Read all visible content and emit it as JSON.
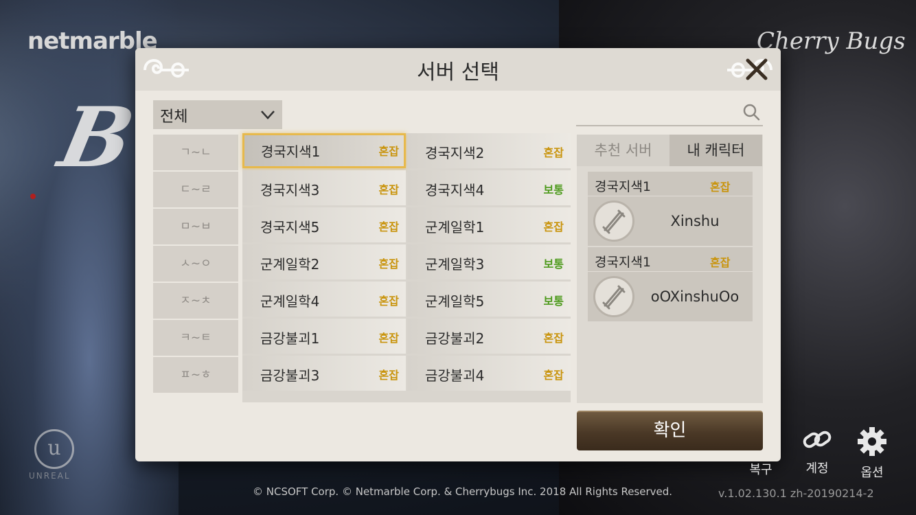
{
  "background": {
    "publisher_logo": "netmarble",
    "developer_logo": "Cherry Bugs",
    "game_logo": "B",
    "engine_logo": "UNREAL",
    "copyright": "© NCSOFT Corp. © Netmarble Corp. & Cherrybugs Inc. 2018 All Rights Reserved.",
    "version": "v.1.02.130.1  zh-20190214-2"
  },
  "bottom_bar": {
    "restore_label": "복구",
    "account_label": "계정",
    "options_label": "옵션"
  },
  "dialog": {
    "title": "서버 선택",
    "filter": {
      "selected": "전체"
    },
    "search": {
      "placeholder": ""
    },
    "initials": [
      "ㄱ~ㄴ",
      "ㄷ~ㄹ",
      "ㅁ~ㅂ",
      "ㅅ~ㅇ",
      "ㅈ~ㅊ",
      "ㅋ~ㅌ",
      "ㅍ~ㅎ"
    ],
    "servers": [
      {
        "name": "경국지색1",
        "status": "혼잡",
        "type": "busy",
        "selected": true
      },
      {
        "name": "경국지색2",
        "status": "혼잡",
        "type": "busy"
      },
      {
        "name": "경국지색3",
        "status": "혼잡",
        "type": "busy"
      },
      {
        "name": "경국지색4",
        "status": "보통",
        "type": "normal"
      },
      {
        "name": "경국지색5",
        "status": "혼잡",
        "type": "busy"
      },
      {
        "name": "군계일학1",
        "status": "혼잡",
        "type": "busy"
      },
      {
        "name": "군계일학2",
        "status": "혼잡",
        "type": "busy"
      },
      {
        "name": "군계일학3",
        "status": "보통",
        "type": "normal"
      },
      {
        "name": "군계일학4",
        "status": "혼잡",
        "type": "busy"
      },
      {
        "name": "군계일학5",
        "status": "보통",
        "type": "normal"
      },
      {
        "name": "금강불괴1",
        "status": "혼잡",
        "type": "busy"
      },
      {
        "name": "금강불괴2",
        "status": "혼잡",
        "type": "busy"
      },
      {
        "name": "금강불괴3",
        "status": "혼잡",
        "type": "busy"
      },
      {
        "name": "금강불괴4",
        "status": "혼잡",
        "type": "busy"
      }
    ],
    "tabs": {
      "recommended": "추천 서버",
      "my_characters": "내 캐릭터"
    },
    "characters": [
      {
        "server": "경국지색1",
        "status": "혼잡",
        "name": "Xinshu"
      },
      {
        "server": "경국지색1",
        "status": "혼잡",
        "name": "oOXinshuOo"
      }
    ],
    "confirm_label": "확인"
  },
  "colors": {
    "busy": "#c9940d",
    "normal": "#4d9a1c",
    "selected_border": "#e7b94c",
    "confirm_button": "#4a3826"
  }
}
